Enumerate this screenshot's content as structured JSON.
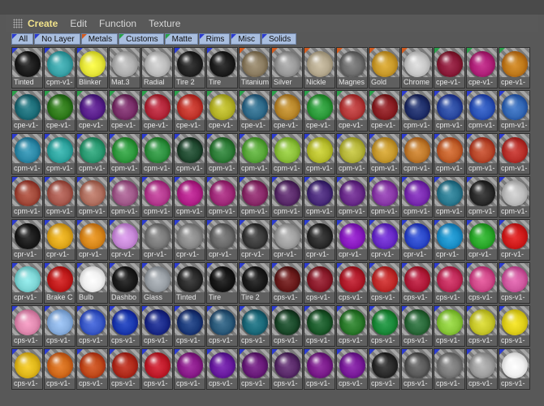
{
  "menu": {
    "items": [
      "Create",
      "Edit",
      "Function",
      "Texture"
    ],
    "active": 0
  },
  "filters": [
    {
      "label": "All",
      "tri": "#2b3bd0"
    },
    {
      "label": "No Layer",
      "tri": "#2b3bd0"
    },
    {
      "label": "Metals",
      "tri": "#d25a1e"
    },
    {
      "label": "Customs",
      "tri": "#2aa04a"
    },
    {
      "label": "Matte",
      "tri": "#2aa04a"
    },
    {
      "label": "Rims",
      "tri": "#2b3bd0"
    },
    {
      "label": "Misc",
      "tri": "#2b3bd0"
    },
    {
      "label": "Solids",
      "tri": "#2b3bd0"
    }
  ],
  "materials": [
    [
      [
        "Tinted",
        "#1a1a1a",
        "#2b3bd0"
      ],
      [
        "cpm-v1-",
        "#3aa3a8",
        "#2b3bd0"
      ],
      [
        "Blinker",
        "#e7e73a",
        "#2b3bd0"
      ],
      [
        "Mat.3",
        "#b0b0b0",
        ""
      ],
      [
        "Radial",
        "#bdbdbd",
        ""
      ],
      [
        "Tire 2",
        "#222222",
        "#2b3bd0"
      ],
      [
        "Tire",
        "#1c1c1c",
        "#2b3bd0"
      ],
      [
        "Titanium",
        "#8c7d62",
        "#d25a1e"
      ],
      [
        "Silver",
        "#9a9a9a",
        "#d25a1e"
      ],
      [
        "Nickle",
        "#b5a98f",
        "#d25a1e"
      ],
      [
        "Magnes",
        "#6e6e6e",
        "#d25a1e"
      ],
      [
        "Gold",
        "#c99a2a",
        "#d25a1e"
      ],
      [
        "Chrome",
        "#c8c8c8",
        "#d25a1e"
      ],
      [
        "cpe-v1-",
        "#8b1a3a",
        "#2aa04a"
      ],
      [
        "cpe-v1-",
        "#b0207a",
        "#2aa04a"
      ],
      [
        "cpe-v1-",
        "#c07a1a",
        "#2aa04a"
      ]
    ],
    [
      [
        "cpe-v1-",
        "#1c6e79",
        "#2aa04a"
      ],
      [
        "cpe-v1-",
        "#2f7a1a",
        "#2aa04a"
      ],
      [
        "cpe-v1-",
        "#5a1f8c",
        "#2aa04a"
      ],
      [
        "cpe-v1-",
        "#7a2f6a",
        "#2aa04a"
      ],
      [
        "cpe-v1-",
        "#b3263a",
        "#2aa04a"
      ],
      [
        "cpe-v1-",
        "#c1352b",
        "#2aa04a"
      ],
      [
        "cpe-v1-",
        "#b6b428",
        "#2aa04a"
      ],
      [
        "cpe-v1-",
        "#2f6b8a",
        "#2aa04a"
      ],
      [
        "cpe-v1-",
        "#b8872a",
        "#2aa04a"
      ],
      [
        "cpe-v1-",
        "#2c9a3a",
        "#2aa04a"
      ],
      [
        "cpe-v1-",
        "#b53a3a",
        "#2aa04a"
      ],
      [
        "cpe-v1-",
        "#8a1d22",
        "#2aa04a"
      ],
      [
        "cpm-v1-",
        "#1f2f6a",
        "#2b3bd0"
      ],
      [
        "cpm-v1-",
        "#2a4aa0",
        "#2b3bd0"
      ],
      [
        "cpm-v1-",
        "#2b55b8",
        "#2b3bd0"
      ],
      [
        "cpm-v1-",
        "#3368b5",
        "#2b3bd0"
      ]
    ],
    [
      [
        "cpm-v1-",
        "#2d8aa8",
        "#2b3bd0"
      ],
      [
        "cpm-v1-",
        "#2fa5a0",
        "#2b3bd0"
      ],
      [
        "cpm-v1-",
        "#2a9a72",
        "#2b3bd0"
      ],
      [
        "cpm-v1-",
        "#2f9a3f",
        "#2b3bd0"
      ],
      [
        "cpm-v1-",
        "#2e9140",
        "#2b3bd0"
      ],
      [
        "cpm-v1-",
        "#204a30",
        "#2b3bd0"
      ],
      [
        "cpm-v1-",
        "#2e7d38",
        "#2b3bd0"
      ],
      [
        "cpm-v1-",
        "#5aa83a",
        "#2b3bd0"
      ],
      [
        "cpm-v1-",
        "#8cc03a",
        "#2b3bd0"
      ],
      [
        "cpm-v1-",
        "#b9bf2d",
        "#2b3bd0"
      ],
      [
        "cpm-v1-",
        "#b6b63a",
        "#2b3bd0"
      ],
      [
        "cpm-v1-",
        "#c79a2d",
        "#2b3bd0"
      ],
      [
        "cpm-v1-",
        "#c07a2b",
        "#2b3bd0"
      ],
      [
        "cpm-v1-",
        "#c2602a",
        "#2b3bd0"
      ],
      [
        "cpm-v1-",
        "#b8482a",
        "#2b3bd0"
      ],
      [
        "cpm-v1-",
        "#b8302a",
        "#2b3bd0"
      ]
    ],
    [
      [
        "cpm-v1-",
        "#a24a3a",
        "#2b3bd0"
      ],
      [
        "cpm-v1-",
        "#a85a4f",
        "#2b3bd0"
      ],
      [
        "cpm-v1-",
        "#b07060",
        "#2b3bd0"
      ],
      [
        "cpm-v1-",
        "#a05a8a",
        "#2b3bd0"
      ],
      [
        "cpm-v1-",
        "#b43a8f",
        "#2b3bd0"
      ],
      [
        "cpm-v1-",
        "#b2208a",
        "#2b3bd0"
      ],
      [
        "cpm-v1-",
        "#a02a7a",
        "#2b3bd0"
      ],
      [
        "cpm-v1-",
        "#8a2a6a",
        "#2b3bd0"
      ],
      [
        "cpm-v1-",
        "#5a2a6a",
        "#2b3bd0"
      ],
      [
        "cpm-v1-",
        "#4a2a7a",
        "#2b3bd0"
      ],
      [
        "cpm-v1-",
        "#6a2a8a",
        "#2b3bd0"
      ],
      [
        "cpm-v1-",
        "#8a3aa8",
        "#2b3bd0"
      ],
      [
        "cpm-v1-",
        "#7a2ab0",
        "#2b3bd0"
      ],
      [
        "cpm-v1-",
        "#2a7a90",
        "#2b3bd0"
      ],
      [
        "cpm-v1-",
        "#2a2a2a",
        "#2b3bd0"
      ],
      [
        "cpm-v1-",
        "#bdbdbd",
        "#2b3bd0"
      ]
    ],
    [
      [
        "cpr-v1-",
        "#1a1a1a",
        "#2b3bd0"
      ],
      [
        "cpr-v1-",
        "#e0a81a",
        "#2b3bd0"
      ],
      [
        "cpr-v1-",
        "#d8881a",
        "#2b3bd0"
      ],
      [
        "cpr-v1-",
        "#c88ad8",
        "#2b3bd0"
      ],
      [
        "cpr-v1-",
        "#7a7a7a",
        "#2b3bd0"
      ],
      [
        "cpr-v1-",
        "#8a8a8a",
        "#2b3bd0"
      ],
      [
        "cpr-v1-",
        "#6a6a6a",
        "#2b3bd0"
      ],
      [
        "cpr-v1-",
        "#3a3a3a",
        "#2b3bd0"
      ],
      [
        "cpr-v1-",
        "#a0a0a0",
        "#2b3bd0"
      ],
      [
        "cpr-v1-",
        "#2a2a2a",
        "#2b3bd0"
      ],
      [
        "cpr-v1-",
        "#8a1ac0",
        "#2b3bd0"
      ],
      [
        "cpr-v1-",
        "#6a2ac8",
        "#2b3bd0"
      ],
      [
        "cpr-v1-",
        "#2a48c8",
        "#2b3bd0"
      ],
      [
        "cpr-v1-",
        "#1a90c8",
        "#2b3bd0"
      ],
      [
        "cpr-v1-",
        "#2aa82a",
        "#2b3bd0"
      ],
      [
        "cpr-v1-",
        "#d01a1a",
        "#2b3bd0"
      ]
    ],
    [
      [
        "cpr-v1-",
        "#7fd6d6",
        "#2b3bd0"
      ],
      [
        "Brake C",
        "#c01a1a",
        "#2b3bd0"
      ],
      [
        "Bulb",
        "#f0f0f0",
        "#2b3bd0"
      ],
      [
        "Dashbo",
        "#1a1a1a",
        "#2b3bd0"
      ],
      [
        "Glass",
        "#9aa0a6",
        "#2b3bd0"
      ],
      [
        "Tinted",
        "#2a2a2a",
        "#2b3bd0"
      ],
      [
        "Tire",
        "#151515",
        "#2b3bd0"
      ],
      [
        "Tire 2",
        "#1a1a1a",
        "#2b3bd0"
      ],
      [
        "cps-v1-",
        "#6a1a1a",
        "#2b3bd0"
      ],
      [
        "cps-v1-",
        "#8a1a2a",
        "#2b3bd0"
      ],
      [
        "cps-v1-",
        "#b01a2a",
        "#2b3bd0"
      ],
      [
        "cps-v1-",
        "#c02a2a",
        "#2b3bd0"
      ],
      [
        "cps-v1-",
        "#b01a3a",
        "#2b3bd0"
      ],
      [
        "cps-v1-",
        "#c02a5a",
        "#2b3bd0"
      ],
      [
        "cps-v1-",
        "#d04a8a",
        "#2b3bd0"
      ],
      [
        "cps-v1-",
        "#d05aa0",
        "#2b3bd0"
      ]
    ],
    [
      [
        "cps-v1-",
        "#e08ab0",
        "#2b3bd0"
      ],
      [
        "cps-v1-",
        "#8ab0e0",
        "#2b3bd0"
      ],
      [
        "cps-v1-",
        "#3a5ac8",
        "#2b3bd0"
      ],
      [
        "cps-v1-",
        "#1a3ab0",
        "#2b3bd0"
      ],
      [
        "cps-v1-",
        "#1a2a8a",
        "#2b3bd0"
      ],
      [
        "cps-v1-",
        "#1a3a7a",
        "#2b3bd0"
      ],
      [
        "cps-v1-",
        "#2a5a7a",
        "#2b3bd0"
      ],
      [
        "cps-v1-",
        "#1a6a7a",
        "#2b3bd0"
      ],
      [
        "cps-v1-",
        "#1a4a2a",
        "#2b3bd0"
      ],
      [
        "cps-v1-",
        "#1a5a2a",
        "#2b3bd0"
      ],
      [
        "cps-v1-",
        "#2a7a2a",
        "#2b3bd0"
      ],
      [
        "cps-v1-",
        "#1a8a3a",
        "#2b3bd0"
      ],
      [
        "cps-v1-",
        "#2a6a3a",
        "#2b3bd0"
      ],
      [
        "cps-v1-",
        "#8ac83a",
        "#2b3bd0"
      ],
      [
        "cps-v1-",
        "#c8c82a",
        "#2b3bd0"
      ],
      [
        "cps-v1-",
        "#e0d01a",
        "#2b3bd0"
      ]
    ],
    [
      [
        "cps-v1-",
        "#e0b81a",
        "#2b3bd0"
      ],
      [
        "cps-v1-",
        "#d06a1a",
        "#2b3bd0"
      ],
      [
        "cps-v1-",
        "#c04a1a",
        "#2b3bd0"
      ],
      [
        "cps-v1-",
        "#b02a1a",
        "#2b3bd0"
      ],
      [
        "cps-v1-",
        "#c01a2a",
        "#2b3bd0"
      ],
      [
        "cps-v1-",
        "#8a1a8a",
        "#2b3bd0"
      ],
      [
        "cps-v1-",
        "#6a1aa0",
        "#2b3bd0"
      ],
      [
        "cps-v1-",
        "#6a1a7a",
        "#2b3bd0"
      ],
      [
        "cps-v1-",
        "#5a2a6a",
        "#2b3bd0"
      ],
      [
        "cps-v1-",
        "#7a1a8a",
        "#2b3bd0"
      ],
      [
        "cps-v1-",
        "#7a1a9a",
        "#2b3bd0"
      ],
      [
        "cps-v1-",
        "#2a2a2a",
        "#2b3bd0"
      ],
      [
        "cps-v1-",
        "#5a5a5a",
        "#2b3bd0"
      ],
      [
        "cps-v1-",
        "#7a7a7a",
        "#2b3bd0"
      ],
      [
        "cps-v1-",
        "#a0a0a0",
        "#2b3bd0"
      ],
      [
        "cps-v1-",
        "#f0f0f0",
        "#2b3bd0"
      ]
    ]
  ]
}
